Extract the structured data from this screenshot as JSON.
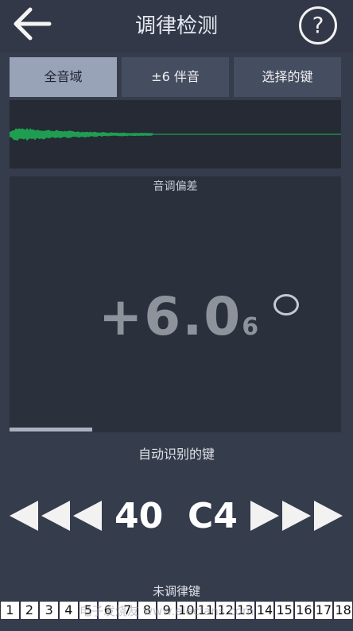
{
  "header": {
    "title": "调律检测",
    "help_label": "?"
  },
  "tabs": [
    {
      "label": "全音域",
      "active": true
    },
    {
      "label": "±6 伴音",
      "active": false
    },
    {
      "label": "选择的键",
      "active": false
    }
  ],
  "deviation_panel": {
    "label": "音调偏差",
    "value": "+6.0",
    "subvalue": "6",
    "progress": 0.25
  },
  "detected_key": {
    "label": "自动识别的键",
    "number": "40",
    "note": "C4"
  },
  "untuned_keys": {
    "label": "未调律键",
    "keys": [
      "1",
      "2",
      "3",
      "4",
      "5",
      "6",
      "7",
      "8",
      "9",
      "10",
      "11",
      "12",
      "13",
      "14",
      "15",
      "16",
      "17",
      "18"
    ]
  },
  "watermark": "电子发烧友 www.elecfans.com",
  "colors": {
    "background": "#353c4c",
    "waveform": "#1f9e52",
    "tab_active": "#99a3b8",
    "tab_inactive": "#454d60"
  },
  "icons": {
    "back": "arrow-left-icon",
    "help": "question-circle-icon",
    "prev": "triple-left-arrow-icon",
    "next": "triple-right-arrow-icon"
  }
}
